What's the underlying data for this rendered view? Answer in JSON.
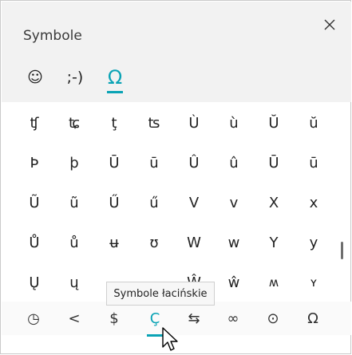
{
  "panel": {
    "title": "Symbole"
  },
  "tabs": [
    {
      "label": "☺",
      "name": "tab-emoji"
    },
    {
      "label": ";-)",
      "name": "tab-kaomoji"
    },
    {
      "label": "Ω",
      "name": "tab-symbols"
    }
  ],
  "symbols": {
    "rows": [
      [
        "ʧ",
        "ʨ",
        "ţ",
        "ʦ",
        "Ù",
        "ù",
        "Ŭ",
        "ŭ"
      ],
      [
        "Þ",
        "þ",
        "Ū",
        "ū",
        "Û",
        "û",
        "Ū",
        "ū"
      ],
      [
        "Ũ",
        "ũ",
        "Ű",
        "ű",
        "V",
        "v",
        "X",
        "x"
      ],
      [
        "Ů",
        "ů",
        "ʉ",
        "ʊ",
        "W",
        "w",
        "Y",
        "y"
      ],
      [
        "Ų",
        "ų",
        "",
        "",
        "Ŵ",
        "ŵ",
        "ʍ",
        "ʏ"
      ]
    ]
  },
  "categories": [
    {
      "label": "◷",
      "name": "category-recent"
    },
    {
      "label": "<",
      "name": "category-punctuation"
    },
    {
      "label": "$",
      "name": "category-currency"
    },
    {
      "label": "Ç",
      "name": "category-latin"
    },
    {
      "label": "⇆",
      "name": "category-arrows"
    },
    {
      "label": "∞",
      "name": "category-math"
    },
    {
      "label": "⊙",
      "name": "category-supplemental"
    },
    {
      "label": "Ω",
      "name": "category-language"
    }
  ],
  "tooltip": {
    "text": "Symbole łacińskie"
  },
  "colors": {
    "accent": "#0aa3b5"
  }
}
